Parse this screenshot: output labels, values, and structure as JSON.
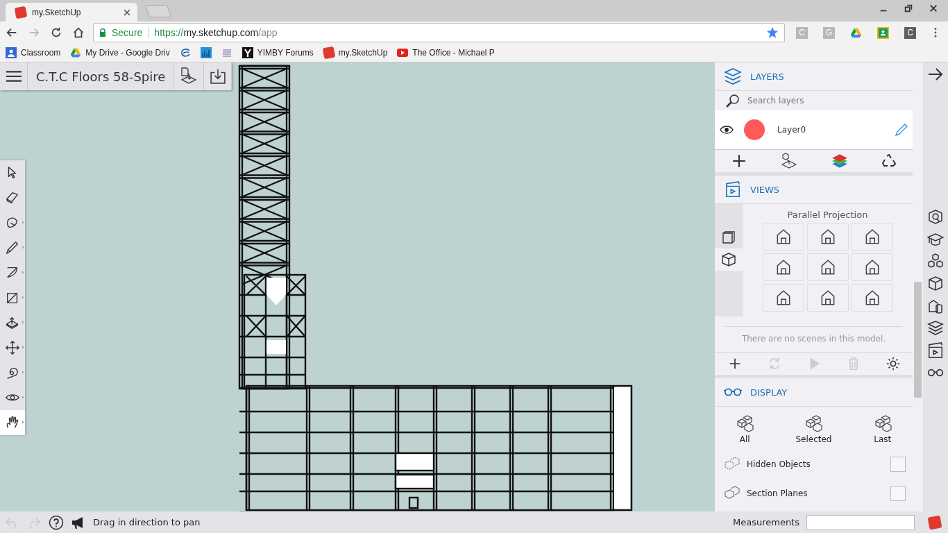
{
  "browser": {
    "tab": {
      "title": "my.SketchUp"
    },
    "address": {
      "secure_label": "Secure",
      "scheme": "https://",
      "host": "my.sketchup.com",
      "path": "/app"
    },
    "extensions": [
      {
        "kind": "letter",
        "label": "C"
      },
      {
        "kind": "letter",
        "label": "G"
      },
      {
        "kind": "drive"
      },
      {
        "kind": "classroom"
      },
      {
        "kind": "dark-letter",
        "label": "C"
      }
    ],
    "bookmarks": [
      {
        "kind": "person",
        "label": "Classroom"
      },
      {
        "kind": "drive",
        "label": "My Drive - Google Driv"
      },
      {
        "kind": "swirl"
      },
      {
        "kind": "chart"
      },
      {
        "kind": "stripes"
      },
      {
        "kind": "y",
        "label": "YIMBY Forums"
      },
      {
        "kind": "sketchup",
        "label": "my.SketchUp"
      },
      {
        "kind": "play",
        "label": "The Office - Michael P"
      }
    ]
  },
  "app": {
    "title": "C.T.C Floors 58-Spire",
    "tools": [
      {
        "kind": "select",
        "flyout": false,
        "selected": false
      },
      {
        "kind": "eraser",
        "flyout": false,
        "selected": false
      },
      {
        "kind": "paint",
        "flyout": true,
        "selected": false
      },
      {
        "kind": "pencil",
        "flyout": true,
        "selected": false
      },
      {
        "kind": "arc",
        "flyout": true,
        "selected": false
      },
      {
        "kind": "rectangle",
        "flyout": true,
        "selected": false
      },
      {
        "kind": "pushpull",
        "flyout": true,
        "selected": false
      },
      {
        "kind": "move",
        "flyout": true,
        "selected": false
      },
      {
        "kind": "tape",
        "flyout": true,
        "selected": false
      },
      {
        "kind": "eye",
        "flyout": true,
        "selected": false
      },
      {
        "kind": "hand",
        "flyout": true,
        "selected": true
      }
    ]
  },
  "layers": {
    "title": "LAYERS",
    "search": {
      "placeholder": "Search layers"
    },
    "items": [
      {
        "name": "Layer0",
        "color": "#ff5a5a",
        "visible": true
      }
    ]
  },
  "views": {
    "title": "VIEWS",
    "projection": "Parallel Projection",
    "camera_tabs": [
      {
        "kind": "square",
        "selected": false
      },
      {
        "kind": "cube",
        "selected": true
      }
    ],
    "empty_message": "There are no scenes in this model.",
    "actions": [
      {
        "kind": "add",
        "disabled": false
      },
      {
        "kind": "refresh",
        "disabled": true
      },
      {
        "kind": "play",
        "disabled": true
      },
      {
        "kind": "delete",
        "disabled": true
      },
      {
        "kind": "settings",
        "disabled": false
      }
    ]
  },
  "display": {
    "title": "DISPLAY",
    "modes": [
      "All",
      "Selected",
      "Last"
    ],
    "options": [
      {
        "label": "Hidden Objects",
        "checked": false
      },
      {
        "label": "Section Planes",
        "checked": false
      }
    ]
  },
  "status_bar": {
    "undo_disabled": true,
    "redo_disabled": true,
    "hint": "Drag in direction to pan",
    "measurements_label": "Measurements"
  }
}
